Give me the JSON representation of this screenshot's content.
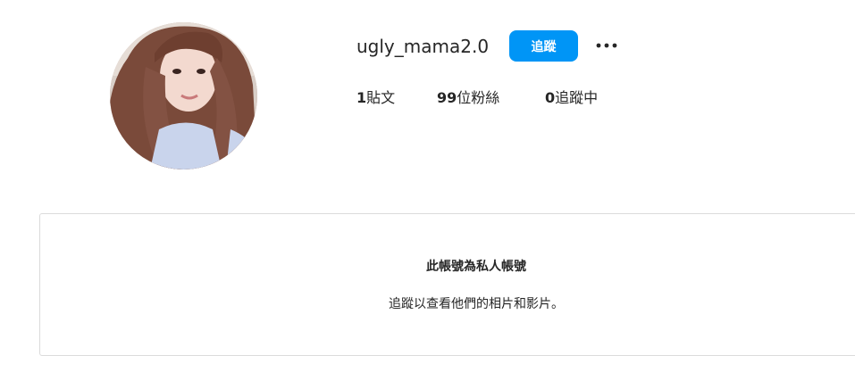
{
  "profile": {
    "username": "ugly_mama2.0",
    "follow_label": "追蹤",
    "more_icon": "more-horizontal-icon",
    "stats": {
      "posts_count": "1",
      "posts_label": "貼文",
      "followers_count": "99",
      "followers_label": "位粉絲",
      "following_count": "0",
      "following_label": "追蹤中"
    }
  },
  "private_notice": {
    "title": "此帳號為私人帳號",
    "subtitle": "追蹤以查看他們的相片和影片。"
  },
  "colors": {
    "accent": "#0095f6",
    "text": "#262626",
    "border": "#dbdbdb"
  }
}
